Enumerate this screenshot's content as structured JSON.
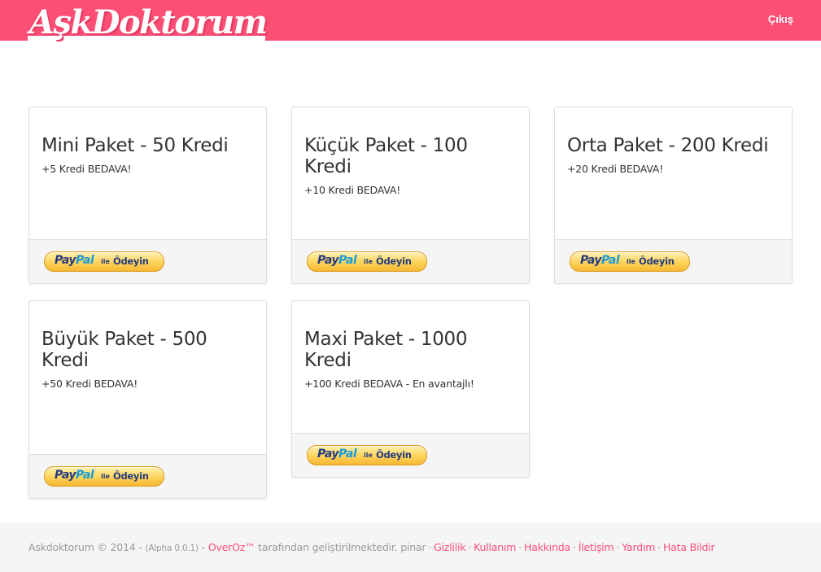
{
  "header": {
    "logo": "AşkDoktorum",
    "logout": "Çıkış"
  },
  "packages": [
    {
      "title": "Mini Paket - 50 Kredi",
      "desc": "+5 Kredi BEDAVA!",
      "pay_button": {
        "pay": "Pay",
        "pal": "Pal",
        "ile": "ile",
        "action": "Ödeyin"
      }
    },
    {
      "title": "Küçük Paket - 100 Kredi",
      "desc": "+10 Kredi BEDAVA!",
      "pay_button": {
        "pay": "Pay",
        "pal": "Pal",
        "ile": "ile",
        "action": "Ödeyin"
      }
    },
    {
      "title": "Orta Paket - 200 Kredi",
      "desc": "+20 Kredi BEDAVA!",
      "pay_button": {
        "pay": "Pay",
        "pal": "Pal",
        "ile": "ile",
        "action": "Ödeyin"
      }
    },
    {
      "title": "Büyük Paket - 500 Kredi",
      "desc": "+50 Kredi BEDAVA!",
      "pay_button": {
        "pay": "Pay",
        "pal": "Pal",
        "ile": "ile",
        "action": "Ödeyin"
      }
    },
    {
      "title": "Maxi Paket - 1000 Kredi",
      "desc": "+100 Kredi BEDAVA - En avantajlı!",
      "pay_button": {
        "pay": "Pay",
        "pal": "Pal",
        "ile": "ile",
        "action": "Ödeyin"
      }
    }
  ],
  "footer": {
    "copyright": "Askdoktorum © 2014 - ",
    "version": "(Alpha 0.0.1)",
    "dash": " - ",
    "developer": "OverOz™",
    "developed_text": " tarafından geliştirilmektedir. pinar",
    "links": [
      "Gizlilik",
      "Kullanım",
      "Hakkında",
      "İletişim",
      "Yardım",
      "Hata Bildir"
    ],
    "separator": "·"
  },
  "colors": {
    "brand": "#fb4f75",
    "paypal_dark": "#253b80",
    "paypal_light": "#179bd7",
    "button_gold": "#fdd35a"
  }
}
